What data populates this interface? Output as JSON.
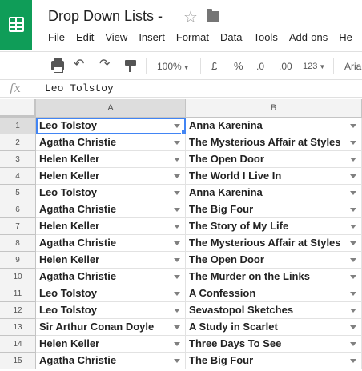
{
  "app": {
    "doc_title": "Drop Down Lists -",
    "menu": [
      "File",
      "Edit",
      "View",
      "Insert",
      "Format",
      "Data",
      "Tools",
      "Add-ons",
      "He"
    ]
  },
  "toolbar": {
    "zoom": "100%",
    "currency": "£",
    "percent": "%",
    "decrease_decimals": ".0",
    "increase_decimals": ".00",
    "more_formats": "123",
    "font": "Aria"
  },
  "formula_bar": {
    "fx_label": "fx",
    "value": "Leo Tolstoy"
  },
  "sheet": {
    "columns": [
      "A",
      "B"
    ],
    "rows": [
      {
        "num": "1",
        "a": "Leo Tolstoy",
        "b": "Anna Karenina"
      },
      {
        "num": "2",
        "a": "Agatha Christie",
        "b": "The Mysterious Affair at Styles"
      },
      {
        "num": "3",
        "a": "Helen Keller",
        "b": "The Open Door"
      },
      {
        "num": "4",
        "a": "Helen Keller",
        "b": "The World I Live In"
      },
      {
        "num": "5",
        "a": "Leo Tolstoy",
        "b": "Anna Karenina"
      },
      {
        "num": "6",
        "a": "Agatha Christie",
        "b": "The Big Four"
      },
      {
        "num": "7",
        "a": "Helen Keller",
        "b": "The Story of My Life"
      },
      {
        "num": "8",
        "a": "Agatha Christie",
        "b": "The Mysterious Affair at Styles"
      },
      {
        "num": "9",
        "a": "Helen Keller",
        "b": "The Open Door"
      },
      {
        "num": "10",
        "a": "Agatha Christie",
        "b": "The Murder on the Links"
      },
      {
        "num": "11",
        "a": "Leo Tolstoy",
        "b": "A Confession"
      },
      {
        "num": "12",
        "a": "Leo Tolstoy",
        "b": "Sevastopol Sketches"
      },
      {
        "num": "13",
        "a": "Sir Arthur Conan Doyle",
        "b": "A Study in Scarlet"
      },
      {
        "num": "14",
        "a": "Helen Keller",
        "b": "Three Days To See"
      },
      {
        "num": "15",
        "a": "Agatha Christie",
        "b": "The Big Four"
      }
    ]
  },
  "colors": {
    "brand_green": "#0f9d58",
    "selection_blue": "#4285f4"
  }
}
